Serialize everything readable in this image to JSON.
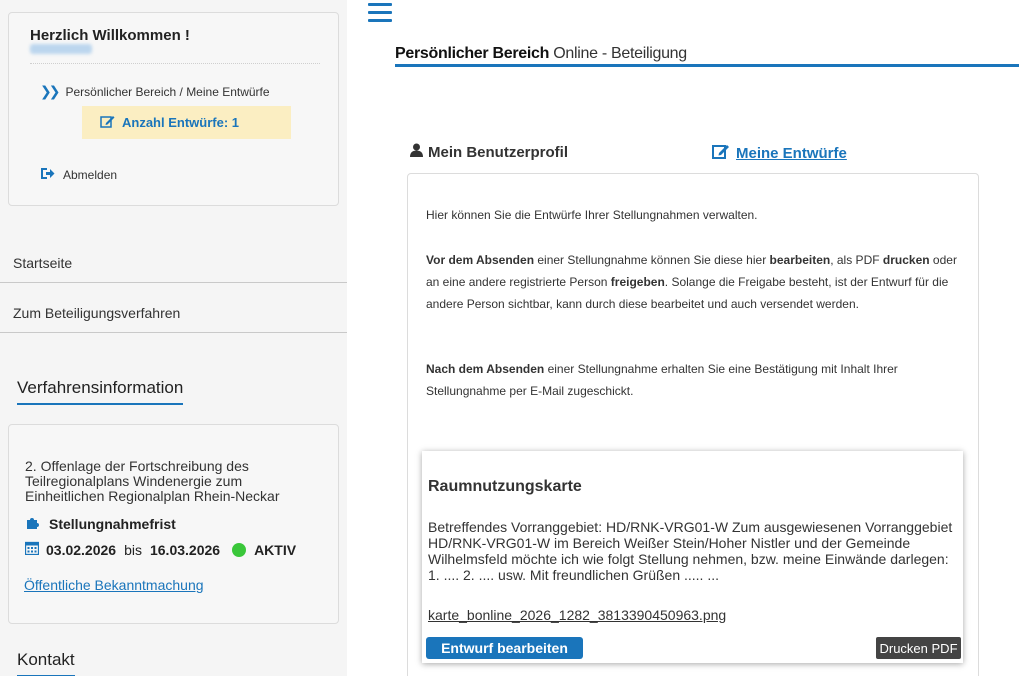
{
  "sidebar": {
    "welcome": "Herzlich Willkommen !",
    "personal_link": "Persönlicher Bereich / Meine Entwürfe",
    "draft_count_label": "Anzahl Entwürfe: 1",
    "logout_label": "Abmelden",
    "nav": [
      {
        "label": "Startseite"
      },
      {
        "label": "Zum Beteiligungsverfahren"
      }
    ],
    "info_heading": "Verfahrensinformation",
    "info": {
      "description": "2. Offenlage der Fortschreibung des Teilregionalplans Windenergie zum Einheitlichen Regionalplan Rhein-Neckar",
      "deadline_label": "Stellungnahmefrist",
      "start_date": "03.02.2026",
      "until": "bis",
      "end_date": "16.03.2026",
      "status": "AKTIV",
      "status_color": "#3ac73a",
      "announcement_link": "Öffentliche Bekanntmachung"
    },
    "contact_heading": "Kontakt"
  },
  "header": {
    "title_bold": "Persönlicher Bereich",
    "title_sub": "Online - Beteiligung"
  },
  "tabs": {
    "profile": "Mein Benutzerprofil",
    "drafts": "Meine Entwürfe"
  },
  "content": {
    "intro": "Hier können Sie die Entwürfe Ihrer Stellungnahmen verwalten.",
    "p2": {
      "a": "Vor dem Absenden",
      "b": " einer Stellungnahme können Sie diese hier ",
      "c": "bearbeiten",
      "d": ", als PDF ",
      "e": "drucken",
      "f": " oder an eine andere registrierte Person ",
      "g": "freigeben",
      "h": ". Solange die Freigabe besteht, ist der Entwurf für die andere Person sichtbar, kann durch diese bearbeitet und auch versendet werden."
    },
    "p3": {
      "a": "Nach dem Absenden",
      "b": " einer Stellungnahme erhalten Sie eine Bestätigung mit Inhalt Ihrer Stellungnahme per E-Mail zugeschickt."
    }
  },
  "draft_card": {
    "title": "Raumnutzungskarte",
    "text": "Betreffendes Vorranggebiet: HD/RNK-VRG01-W Zum ausgewiesenen Vorranggebiet HD/RNK-VRG01-W im Bereich Weißer Stein/Hoher Nistler und der Gemeinde Wilhelmsfeld möchte ich wie folgt Stellung nehmen, bzw. meine Einwände darlegen: 1. .... 2. .... usw. Mit freundlichen Grüßen ..... ...",
    "file": "karte_bonline_2026_1282_3813390450963.png",
    "edit_button": "Entwurf bearbeiten",
    "print_button": "Drucken PDF"
  },
  "colors": {
    "accent": "#1a75bb",
    "highlight": "#fbeec2"
  },
  "icons": {
    "menu": "hamburger-icon",
    "nav": "double-chevron-right-icon",
    "draft": "edit-icon",
    "logout": "sign-out-icon",
    "deadline": "puzzle-icon",
    "calendar": "calendar-icon",
    "profile": "user-icon"
  }
}
